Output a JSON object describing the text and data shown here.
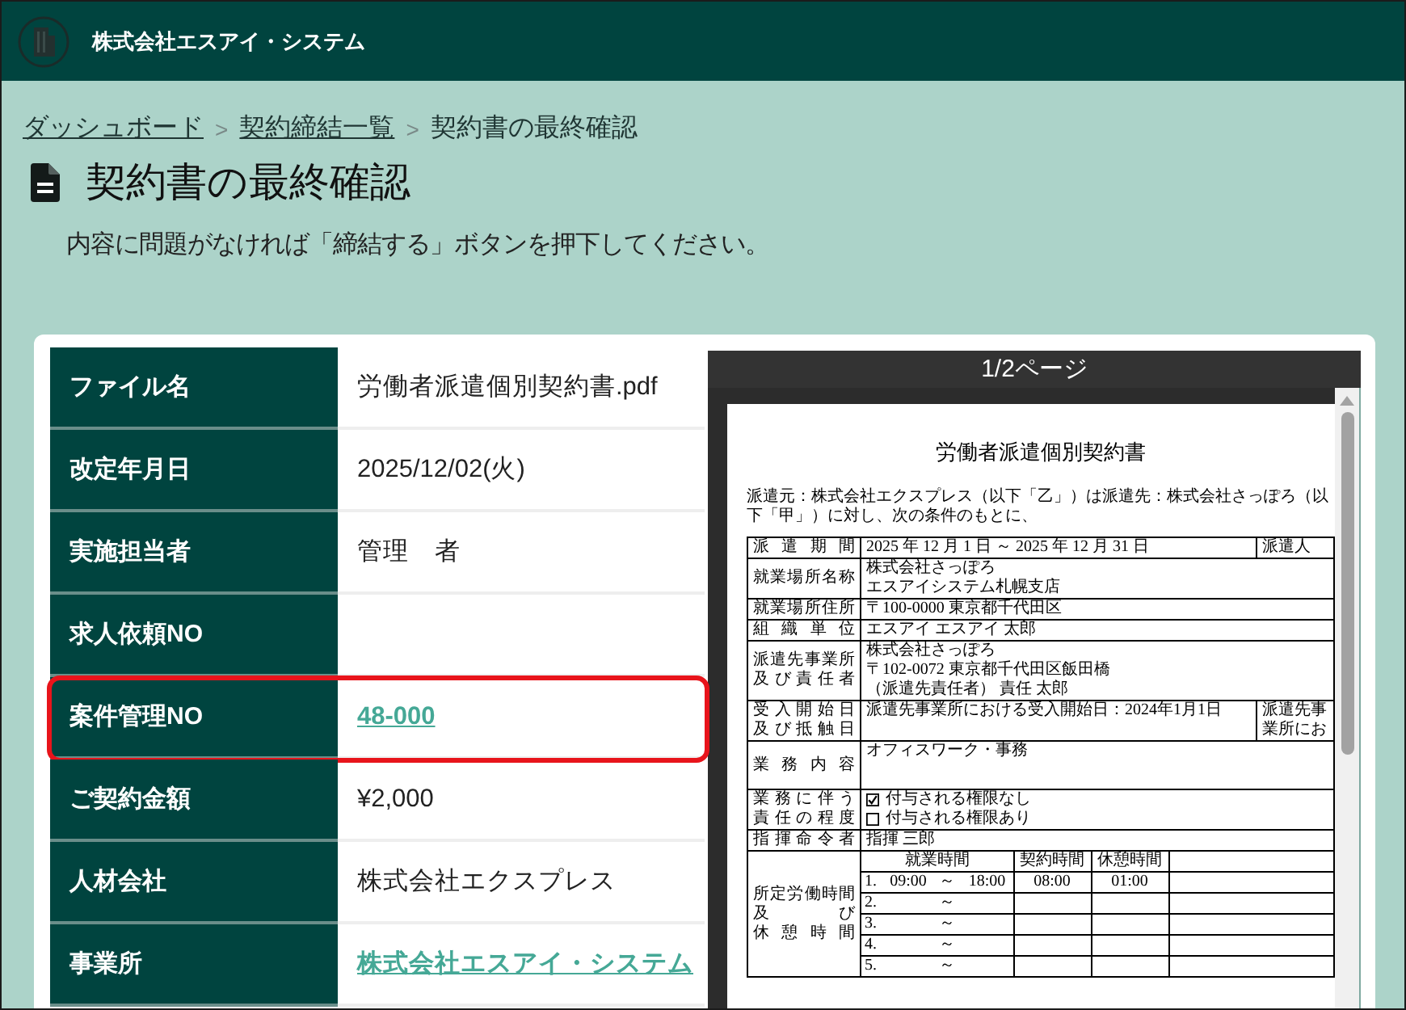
{
  "header": {
    "company": "株式会社エスアイ・システム"
  },
  "breadcrumb": [
    {
      "kind": "link",
      "label": "ダッシュボード"
    },
    {
      "kind": "separator",
      "label": ">"
    },
    {
      "kind": "link",
      "label": "契約締結一覧"
    },
    {
      "kind": "separator",
      "label": ">"
    },
    {
      "kind": "current",
      "label": "契約書の最終確認"
    }
  ],
  "page": {
    "title": "契約書の最終確認",
    "instruction": "内容に問題がなければ「締結する」ボタンを押下してください。"
  },
  "details": [
    {
      "label": "ファイル名",
      "value": "労働者派遣個別契約書.pdf",
      "kind": "text",
      "highlighted": false
    },
    {
      "label": "改定年月日",
      "value": "2025/12/02(火)",
      "kind": "text",
      "highlighted": false
    },
    {
      "label": "実施担当者",
      "value": "管理　者",
      "kind": "text",
      "highlighted": false
    },
    {
      "label": "求人依頼NO",
      "highlighted": false
    },
    {
      "label": "案件管理NO",
      "value": "48-000",
      "kind": "link",
      "highlighted": true
    },
    {
      "label": "ご契約金額",
      "value": "¥2,000",
      "kind": "text",
      "highlighted": false
    },
    {
      "label": "人材会社",
      "value": "株式会社エクスプレス",
      "kind": "text",
      "highlighted": false
    },
    {
      "label": "事業所",
      "value": "株式会社エスアイ・システム",
      "kind": "link",
      "highlighted": false
    }
  ],
  "preview": {
    "page_indicator": "1/2ページ",
    "document": {
      "title": "労働者派遣個別契約書",
      "intro": "派遣元：株式会社エクスプレス（以下「乙」）は派遣先：株式会社さっぽろ（以下「甲」）に対し、次の条件のもとに、",
      "rows": [
        {
          "kind": "text",
          "label": [
            "派遣期間"
          ],
          "lines": [
            "2025 年 12 月 1 日 ～ 2025 年 12 月 31 日"
          ],
          "side": "派遣人"
        },
        {
          "kind": "text",
          "label": [
            "就業場所名称"
          ],
          "lines": [
            "株式会社さっぽろ",
            "エスアイシステム札幌支店"
          ]
        },
        {
          "kind": "text",
          "label": [
            "就業場所住所"
          ],
          "lines": [
            "〒100-0000 東京都千代田区"
          ]
        },
        {
          "kind": "text",
          "label": [
            "組織単位"
          ],
          "lines": [
            "エスアイ エスアイ 太郎"
          ]
        },
        {
          "kind": "text",
          "label": [
            "派遣先事業所",
            "及び責任者"
          ],
          "lines": [
            "株式会社さっぽろ",
            "〒102-0072 東京都千代田区飯田橋",
            "（派遣先責任者） 責任 太郎"
          ]
        },
        {
          "kind": "text",
          "label": [
            "受入開始日",
            "及び抵触日"
          ],
          "lines": [
            "派遣先事業所における受入開始日：2024年1月1日"
          ],
          "side": "派遣先事業所にお"
        },
        {
          "kind": "block",
          "label": [
            "業務内容"
          ],
          "lines": [
            "オフィスワーク・事務"
          ]
        },
        {
          "kind": "checklist",
          "label": [
            "業務に伴う",
            "責任の程度"
          ],
          "items": [
            {
              "text": "付与される権限なし",
              "checked": true
            },
            {
              "text": "付与される権限あり",
              "checked": false
            }
          ]
        },
        {
          "kind": "text",
          "label": [
            "指揮命令者"
          ],
          "lines": [
            "指揮 三郎"
          ]
        },
        {
          "kind": "hours",
          "label": [
            "所定労働時間",
            "及び",
            "休憩時間"
          ],
          "columns": [
            "就業時間",
            "契約時間",
            "休憩時間"
          ],
          "slots": [
            {
              "number": "1.",
              "start": "09:00",
              "separator": "～",
              "end": "18:00",
              "contract": "08:00",
              "break": "01:00"
            },
            {
              "number": "2.",
              "separator": "～"
            },
            {
              "number": "3.",
              "separator": "～"
            },
            {
              "number": "4.",
              "separator": "～"
            },
            {
              "number": "5.",
              "separator": "～"
            }
          ]
        }
      ]
    }
  }
}
